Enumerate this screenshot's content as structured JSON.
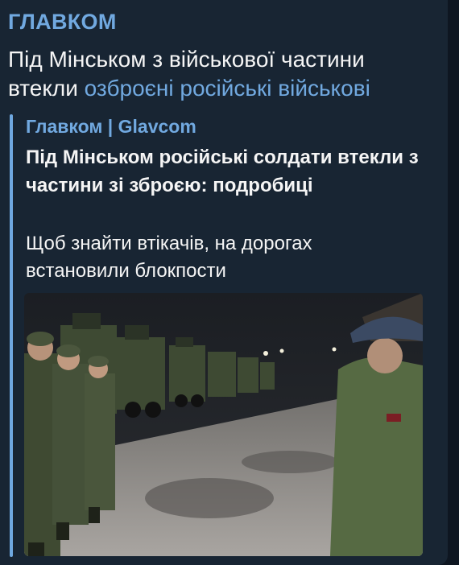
{
  "message": {
    "channel_name": "ГЛАВКОМ",
    "text": "Під Мінськом з військової частини втекли ",
    "link_text": "озброєні російські військові"
  },
  "link_preview": {
    "site_name": "Главком | Glavcom",
    "title": "Під Мінськом російські солдати втекли з частини зі зброєю: подробиці",
    "description": "Щоб знайти втікачів, на дорогах встановили блокпости"
  },
  "colors": {
    "background": "#0e1621",
    "bubble": "#182533",
    "accent": "#71a9e0",
    "text": "#f5f5f5"
  }
}
